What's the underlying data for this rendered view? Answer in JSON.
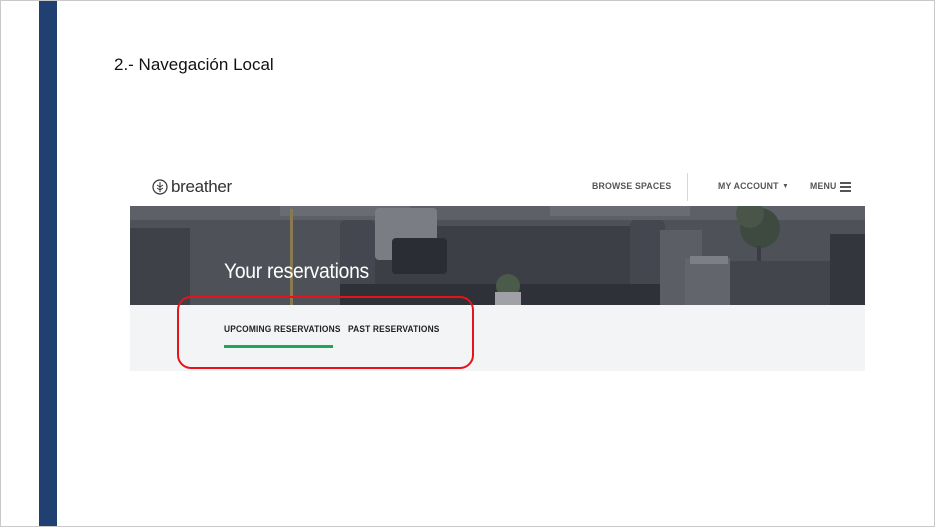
{
  "slide": {
    "title": "2.- Navegación Local"
  },
  "app": {
    "logo_text": "breather",
    "nav": {
      "browse": "BROWSE SPACES",
      "account": "MY ACCOUNT",
      "menu": "MENU"
    },
    "hero_title": "Your reservations",
    "tabs": [
      {
        "label": "UPCOMING RESERVATIONS",
        "active": true
      },
      {
        "label": "PAST RESERVATIONS",
        "active": false
      }
    ]
  },
  "colors": {
    "slide_bar": "#1f4070",
    "active_tab_underline": "#1fa55a",
    "highlight_outline": "#e8121b"
  },
  "icons": [
    "breather-logo-icon",
    "caret-down-icon",
    "hamburger-icon"
  ]
}
